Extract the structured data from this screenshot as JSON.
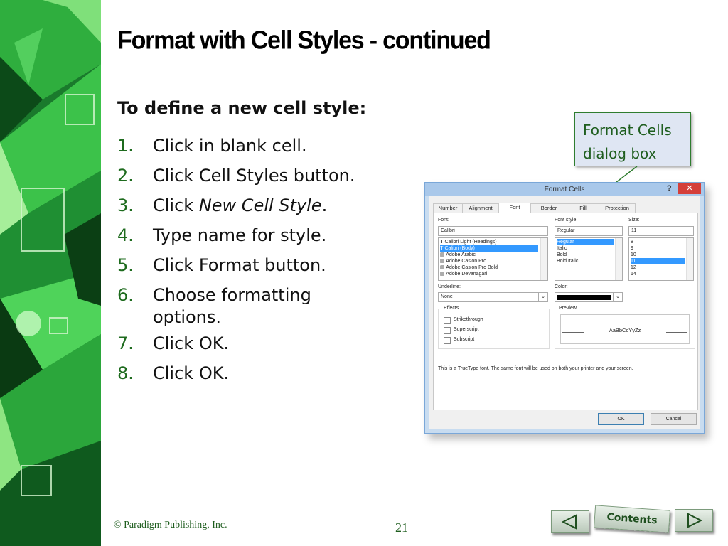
{
  "slide": {
    "title": "Format with Cell Styles - continued",
    "intro": "To define a new cell style:",
    "steps": [
      {
        "num": "1.",
        "text": "Click in blank cell."
      },
      {
        "num": "2.",
        "text": "Click Cell Styles button."
      },
      {
        "num": "3.",
        "text_before": "Click ",
        "text_italic": "New Cell Style",
        "text_after": "."
      },
      {
        "num": "4.",
        "text": "Type name for style."
      },
      {
        "num": "5.",
        "text": "Click Format button."
      },
      {
        "num": "6.",
        "text": "Choose formatting",
        "text2": "options."
      },
      {
        "num": "7.",
        "text": "Click OK."
      },
      {
        "num": "8.",
        "text": "Click OK."
      }
    ],
    "callout": {
      "line1": "Format Cells",
      "line2": "dialog box"
    },
    "footer": {
      "copyright": "© Paradigm Publishing, Inc.",
      "page_number": "21"
    },
    "nav": {
      "prev_icon": "triangle-left-icon",
      "contents_label": "Contents",
      "next_icon": "triangle-right-icon"
    },
    "colors": {
      "accent_green": "#1e6b1e",
      "callout_bg": "#dfe6f3",
      "dialog_titlebar": "#a9c8ea",
      "close_red": "#d43f3a",
      "selection_blue": "#3399ff"
    }
  },
  "dialog": {
    "title": "Format Cells",
    "help": "?",
    "close": "✕",
    "tabs": [
      "Number",
      "Alignment",
      "Font",
      "Border",
      "Fill",
      "Protection"
    ],
    "active_tab": "Font",
    "font_label": "Font:",
    "font_value": "Calibri",
    "font_list": [
      "Calibri Light (Headings)",
      "Calibri (Body)",
      "Adobe Arabic",
      "Adobe Caslon Pro",
      "Adobe Caslon Pro Bold",
      "Adobe Devanagari"
    ],
    "font_selected": "Calibri (Body)",
    "style_label": "Font style:",
    "style_value": "Regular",
    "style_list": [
      "Regular",
      "Italic",
      "Bold",
      "Bold Italic"
    ],
    "style_selected": "Regular",
    "size_label": "Size:",
    "size_value": "11",
    "size_list": [
      "8",
      "9",
      "10",
      "11",
      "12",
      "14"
    ],
    "size_selected": "11",
    "underline_label": "Underline:",
    "underline_value": "None",
    "color_label": "Color:",
    "effects_label": "Effects",
    "effects": [
      "Strikethrough",
      "Superscript",
      "Subscript"
    ],
    "preview_label": "Preview",
    "preview_text": "AaBbCcYyZz",
    "info_text": "This is a TrueType font.  The same font will be used on both your printer and your screen.",
    "ok_label": "OK",
    "cancel_label": "Cancel"
  }
}
